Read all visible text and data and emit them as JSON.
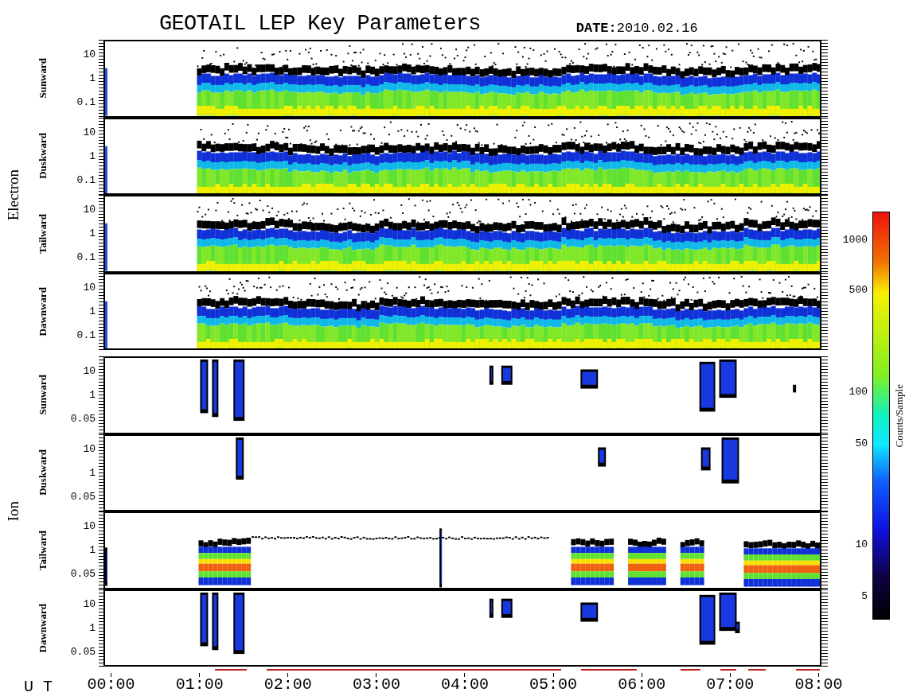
{
  "title": "GEOTAIL LEP Key Parameters",
  "date": "**DATE:**2010.02.16",
  "groups": [
    {
      "kind": "electron",
      "label": "Electron",
      "panels": [
        {
          "label": "Sunward",
          "yticks": [
            "10",
            "1",
            "0.1"
          ]
        },
        {
          "label": "Duskward",
          "yticks": [
            "10",
            "1",
            "0.1"
          ]
        },
        {
          "label": "Tailward",
          "yticks": [
            "10",
            "1",
            "0.1"
          ]
        },
        {
          "label": "Dawnward",
          "yticks": [
            "10",
            "1",
            "0.1"
          ]
        }
      ]
    },
    {
      "kind": "ion",
      "label": "Ion",
      "panels": [
        {
          "label": "Sunward",
          "yticks": [
            "10",
            "1",
            "0.05"
          ]
        },
        {
          "label": "Duskward",
          "yticks": [
            "10",
            "1",
            "0.05"
          ]
        },
        {
          "label": "Tailward",
          "yticks": [
            "10",
            "1",
            "0.05"
          ]
        },
        {
          "label": "Dawnward",
          "yticks": [
            "10",
            "1",
            "0.05"
          ]
        }
      ]
    }
  ],
  "time_axis": {
    "label": "U T",
    "ticks": [
      "00:00",
      "01:00",
      "02:00",
      "03:00",
      "04:00",
      "05:00",
      "06:00",
      "07:00",
      "08:00"
    ]
  },
  "colorbar": {
    "title": "Counts/Sample",
    "ticks": [
      "1000",
      "500",
      "100",
      "50",
      "10",
      "5"
    ]
  }
}
